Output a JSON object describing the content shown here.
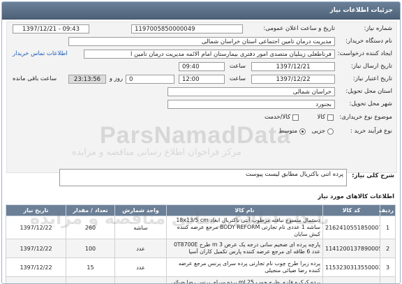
{
  "header": {
    "title": "جزئیات اطلاعات نیاز"
  },
  "form": {
    "need_number_label": "شماره نیاز:",
    "need_number": "1197005850000049",
    "announce_label": "تاریخ و ساعت اعلان عمومی:",
    "announce_value": "1397/12/21 - 09:43",
    "buyer_org_label": "نام دستگاه خریدار:",
    "buyer_org": "مدیریت درمان تامین اجتماعی استان خراسان شمالی",
    "creator_label": "ایجاد کننده درخواست:",
    "creator": "فرناطعلی زینلیان متصدی امور دفتری بیمارستان امام الائمه مدیریت درمان تامین ا",
    "contact_link": "اطلاعات تماس خریدار",
    "send_date_label": "تاریخ ارسال نیاز:",
    "send_date": "1397/12/21",
    "send_time_label": "ساعت",
    "send_time": "09:40",
    "deadline_label": "تاریخ اعتبار نیاز:",
    "deadline_date": "1397/12/22",
    "deadline_time_label": "ساعت",
    "deadline_time": "12:00",
    "days_value": "0",
    "days_label": "روز و",
    "remaining_timer": "23:13:56",
    "remaining_label": "ساعت باقی مانده",
    "province_label": "استان محل تحویل:",
    "province": "خراسان شمالی",
    "city_label": "شهر محل تحویل:",
    "city": "بجنورد",
    "type_label": "موضوع نوع خریداری:",
    "type_options": [
      "کالا",
      "کالا/خدمت"
    ],
    "process_label": "نوع فرآیند خرید :",
    "process_options": [
      "جزیی",
      "متوسط"
    ],
    "process_selected": "متوسط"
  },
  "summary": {
    "label": "شرح کلی نیاز:",
    "value": "پرده اتنی باکتریال مطابق لیست پیوست"
  },
  "goods": {
    "title": "اطلاعات کالاهای مورد نیاز",
    "columns": [
      "ردیف",
      "کد کالا",
      "نام کالا",
      "واحد شمارش",
      "تعداد / مقدار",
      "تاریخ نیاز"
    ],
    "rows": [
      {
        "row": "1",
        "code": "2162410551850007",
        "name": "دستمال منسوج نبافته مرطوب آنتی باکتریال ابعاد 18x13/5 cm ساشه 1 عددی نام تجارتی BODY REFORM مرجع عرضه کننده کیش سایان",
        "unit": "ساشه",
        "qty": "260",
        "date": "1397/12/22"
      },
      {
        "row": "2",
        "code": "1141200137890005",
        "name": "پارچه پرده ای ضخیم سانی درجه یک عرض 3 m طرح 0T8700E عدد 6 طاقه ای مرجع عرضه کننده پارس تکمیل کاران آسیا",
        "unit": "عدد",
        "qty": "100",
        "date": "1397/12/22"
      },
      {
        "row": "3",
        "code": "1153230313550003",
        "name": "پرده زبرا طرح چوب نام تجارتی پرده سرای پرنس مرجع عرضه کننده رضا ضیائی منجیلی",
        "unit": "عدد",
        "qty": "15",
        "date": "1397/12/22"
      },
      {
        "row": "4",
        "code": "1153230313550003",
        "name": "پرده کرکره فلزی طرح چوب 25 ml پرده سرای پرنس رضا ضیائی منجیلی",
        "unit": "عدد",
        "qty": "15",
        "date": "1397/12/22"
      }
    ]
  },
  "watermark": {
    "line1": "ParsNamadData",
    "line2": "مرکز فراخوان اطلاع رسانی مناقصه و مزایده",
    "line3": "پایگاه اطلاع رسانی مناقصه و مزایده"
  },
  "colors": {
    "header": "#5d7289",
    "table_header": "#6b7f96",
    "link": "#1a5bb8"
  }
}
